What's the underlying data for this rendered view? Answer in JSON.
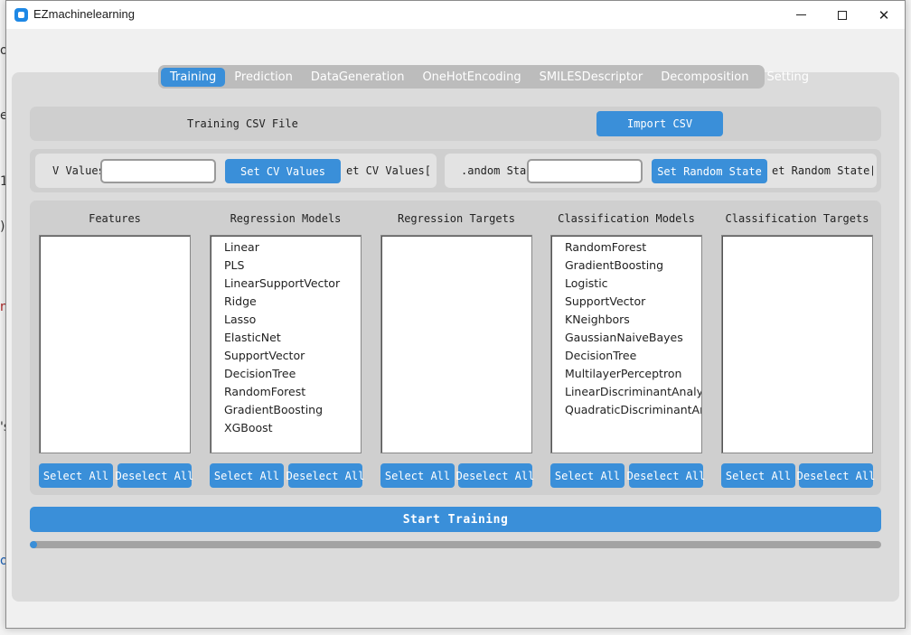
{
  "window": {
    "title": "EZmachinelearning",
    "controls": {
      "minimize": "–",
      "maximize": "□",
      "close": "✕"
    }
  },
  "tabs": [
    {
      "label": "Training",
      "active": true
    },
    {
      "label": "Prediction",
      "active": false
    },
    {
      "label": "DataGeneration",
      "active": false
    },
    {
      "label": "OneHotEncoding",
      "active": false
    },
    {
      "label": "SMILESDescriptor",
      "active": false
    },
    {
      "label": "Decomposition",
      "active": false
    },
    {
      "label": "Setting",
      "active": false
    }
  ],
  "csv": {
    "label": "Training CSV File",
    "button": "Import CSV"
  },
  "cv": {
    "label": "V Values",
    "input_value": "",
    "button": "Set CV Values",
    "status": "et CV Values["
  },
  "random_state": {
    "label": ".andom State",
    "input_value": "",
    "button": "Set Random State",
    "status": "et Random State["
  },
  "columns": [
    {
      "title": "Features",
      "items": []
    },
    {
      "title": "Regression Models",
      "items": [
        "Linear",
        "PLS",
        "LinearSupportVector",
        "Ridge",
        "Lasso",
        "ElasticNet",
        "SupportVector",
        "DecisionTree",
        "RandomForest",
        "GradientBoosting",
        "XGBoost"
      ]
    },
    {
      "title": "Regression Targets",
      "items": []
    },
    {
      "title": "Classification Models",
      "items": [
        "RandomForest",
        "GradientBoosting",
        "Logistic",
        "SupportVector",
        "KNeighbors",
        "GaussianNaiveBayes",
        "DecisionTree",
        "MultilayerPerceptron",
        "LinearDiscriminantAnalysis",
        "QuadraticDiscriminantAnalysis"
      ]
    },
    {
      "title": "Classification Targets",
      "items": []
    }
  ],
  "select_all_label": "Select All",
  "deselect_all_label": "Deselect All",
  "start_button": "Start Training",
  "progress": 0.006,
  "background_fragments": [
    "or",
    "e",
    "1",
    ")",
    "n",
    "'s",
    "o"
  ],
  "colors": {
    "accent": "#3a8fd9",
    "panel": "#dbdbdb",
    "frame": "#cfcfcf",
    "progress_track": "#a3a3a3"
  }
}
